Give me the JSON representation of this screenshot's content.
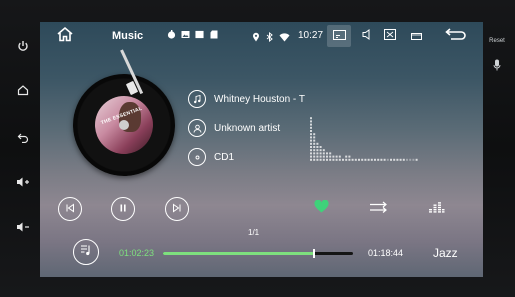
{
  "device": {
    "right_label": "Reset"
  },
  "statusbar": {
    "title": "Music",
    "time": "10:27"
  },
  "track": {
    "title": "Whitney Houston - T",
    "artist": "Unknown artist",
    "album": "CD1",
    "cover_text": "THE ESSENTIAL"
  },
  "playback": {
    "page": "1/1",
    "elapsed": "01:02:23",
    "total": "01:18:44",
    "progress_fraction": 0.793,
    "eq_preset": "Jazz",
    "favorite": true
  },
  "spectrum": {
    "levels": [
      14,
      9,
      6,
      5,
      4,
      3,
      3,
      2,
      2,
      2,
      1,
      2,
      2,
      1,
      1,
      1,
      1,
      1,
      1,
      1,
      1,
      1,
      1,
      1,
      0,
      1,
      1,
      1,
      1,
      1,
      0,
      0,
      0,
      1
    ]
  },
  "colors": {
    "accent_green": "#7ee07e",
    "heart": "#3fd27a"
  },
  "icons": {
    "side": [
      "power-icon",
      "home-icon",
      "back-icon",
      "volume-up-icon",
      "volume-down-icon"
    ],
    "status": [
      "music-icon",
      "image-icon",
      "window-icon",
      "sd-icon",
      "location-icon",
      "bluetooth-icon",
      "wifi-icon"
    ]
  }
}
